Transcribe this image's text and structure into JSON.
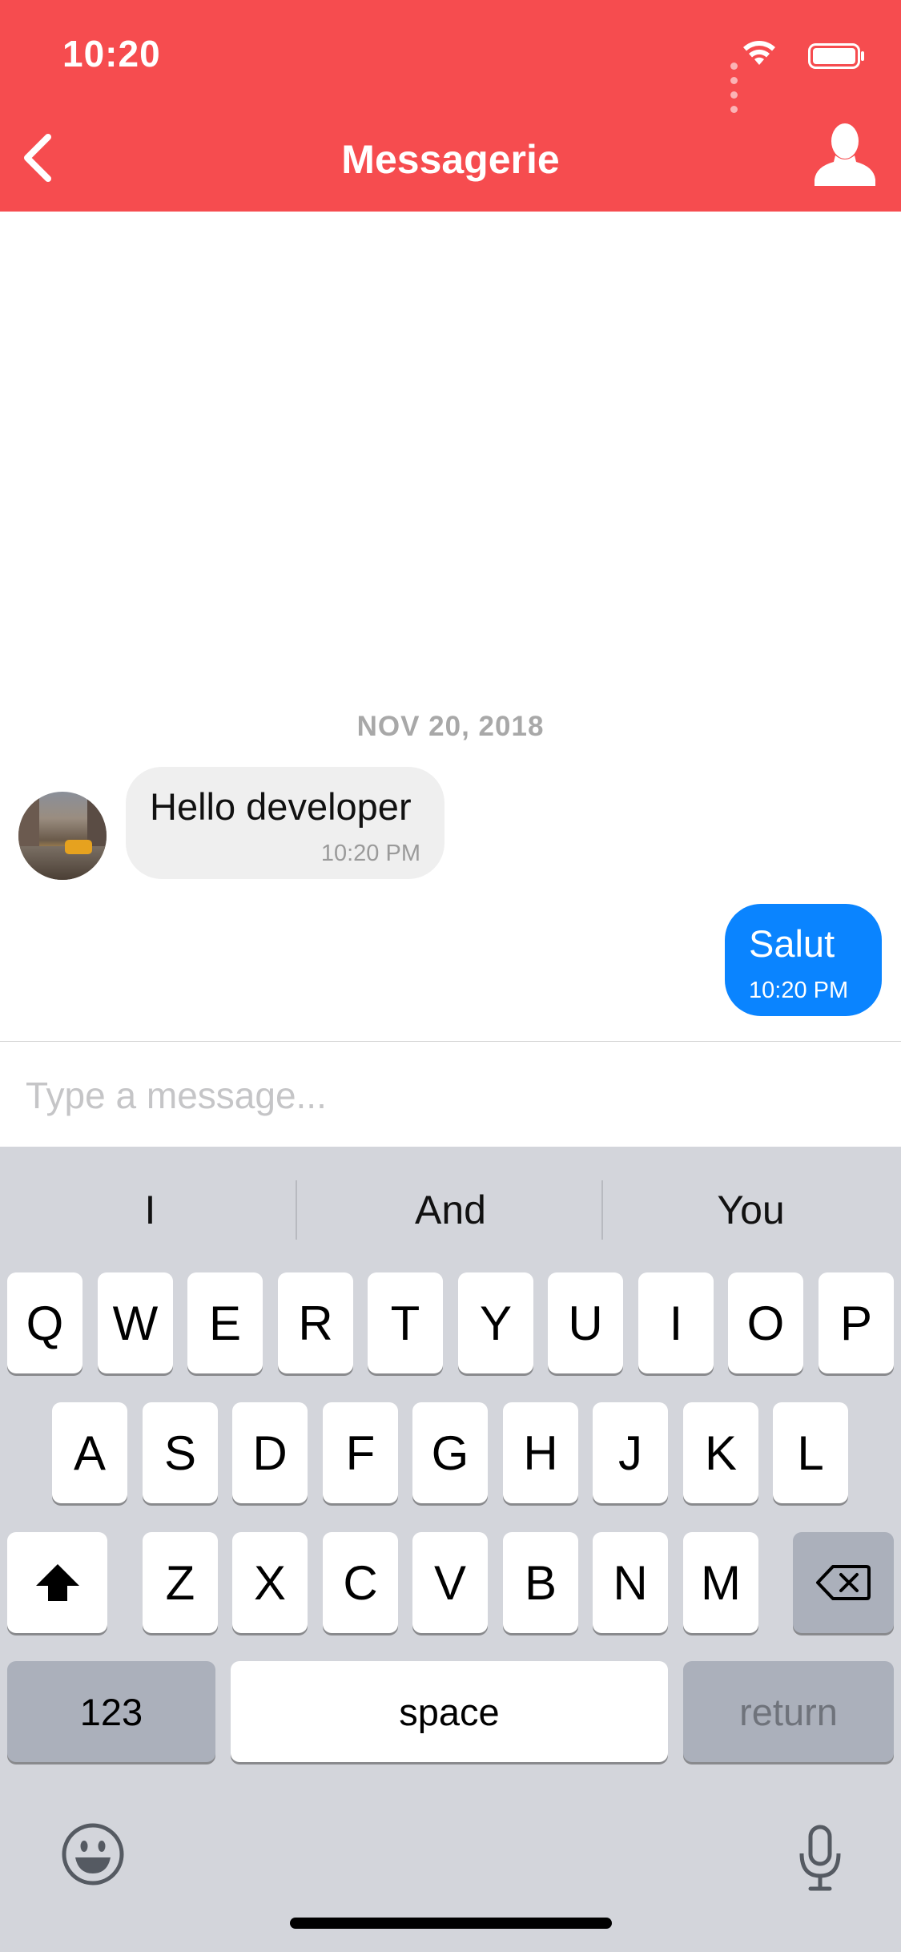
{
  "status_bar": {
    "time": "10:20"
  },
  "nav": {
    "title": "Messagerie",
    "back_icon": "chevron-left-icon",
    "profile_icon": "user-silhouette-icon"
  },
  "colors": {
    "header": "#f64c4f",
    "outgoing_bubble": "#0a84ff",
    "incoming_bubble": "#efefef",
    "keyboard": "#d3d5db"
  },
  "chat": {
    "date": "NOV 20, 2018",
    "messages": [
      {
        "direction": "incoming",
        "text": "Hello developer",
        "time": "10:20 PM"
      },
      {
        "direction": "outgoing",
        "text": "Salut",
        "time": "10:20 PM"
      }
    ]
  },
  "composer": {
    "placeholder": "Type a message..."
  },
  "keyboard": {
    "suggestions": [
      "I",
      "And",
      "You"
    ],
    "row1": [
      "Q",
      "W",
      "E",
      "R",
      "T",
      "Y",
      "U",
      "I",
      "O",
      "P"
    ],
    "row2": [
      "A",
      "S",
      "D",
      "F",
      "G",
      "H",
      "J",
      "K",
      "L"
    ],
    "row3": [
      "Z",
      "X",
      "C",
      "V",
      "B",
      "N",
      "M"
    ],
    "numbers_label": "123",
    "space_label": "space",
    "return_label": "return",
    "shift_icon": "shift-icon",
    "delete_icon": "backspace-icon",
    "emoji_icon": "emoji-icon",
    "mic_icon": "microphone-icon"
  }
}
